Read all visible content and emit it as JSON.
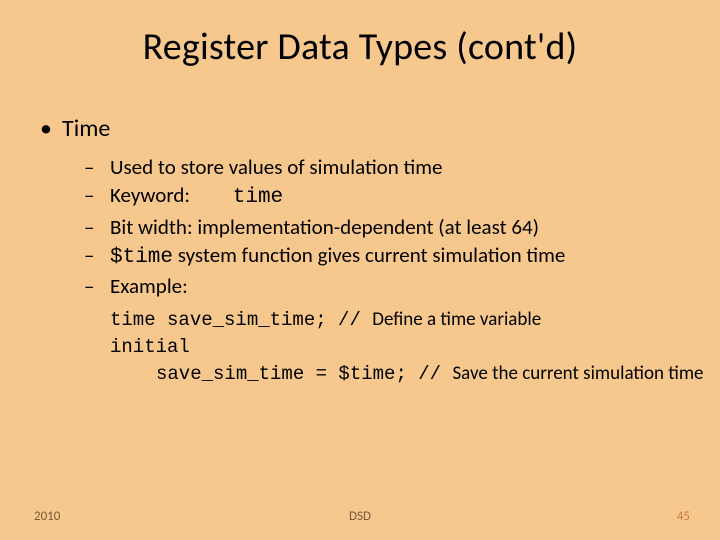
{
  "title": "Register Data Types (cont'd)",
  "bullet1": {
    "marker": "•",
    "text": "Time"
  },
  "sub": {
    "dash": "–",
    "items": [
      "Used to store values of simulation time",
      "",
      "Bit width: implementation-dependent (at least 64)",
      "",
      "Example:"
    ],
    "keyword_label": "Keyword:",
    "keyword_value": "time",
    "stime_pre": "$time",
    "stime_post": " system function gives current simulation time"
  },
  "code": {
    "l1_mono": "time save_sim_time; // ",
    "l1_rest": "Define a time variable",
    "l2_mono": "initial",
    "l3_mono": "save_sim_time = $time; // ",
    "l3_rest": "Save the current simulation time"
  },
  "footer": {
    "year": "2010",
    "center": "DSD",
    "page": "45"
  }
}
